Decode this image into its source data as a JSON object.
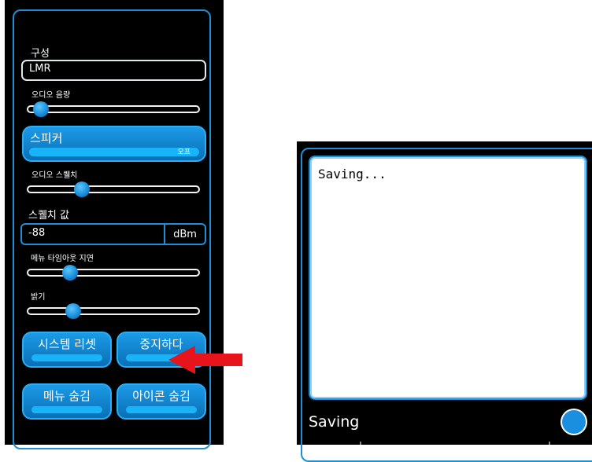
{
  "left": {
    "config_label": "구성",
    "config_value": "LMR",
    "audio_volume_label": "오디오 음량",
    "audio_volume_level": 0.08,
    "speaker": {
      "label": "스피커",
      "value": "오프"
    },
    "audio_squelch_label": "오디오 스퀠치",
    "audio_squelch_level": 0.32,
    "squelch_value_label": "스퀠치 값",
    "squelch_value": "-88",
    "squelch_unit": "dBm",
    "menu_timeout_label": "메뉴 타임아웃 지연",
    "menu_timeout_level": 0.25,
    "brightness_label": "밝기",
    "brightness_level": 0.27,
    "buttons": {
      "system_reset": "시스템 리셋",
      "stop": "중지하다",
      "hide_menu": "메뉴 숨김",
      "hide_icons": "아이콘 숨김"
    }
  },
  "right": {
    "message": "Saving...",
    "status": "Saving"
  },
  "colors": {
    "accent": "#1e8fd6",
    "button": "#1483d0",
    "arrow": "#e8141b",
    "background": "#000000"
  }
}
